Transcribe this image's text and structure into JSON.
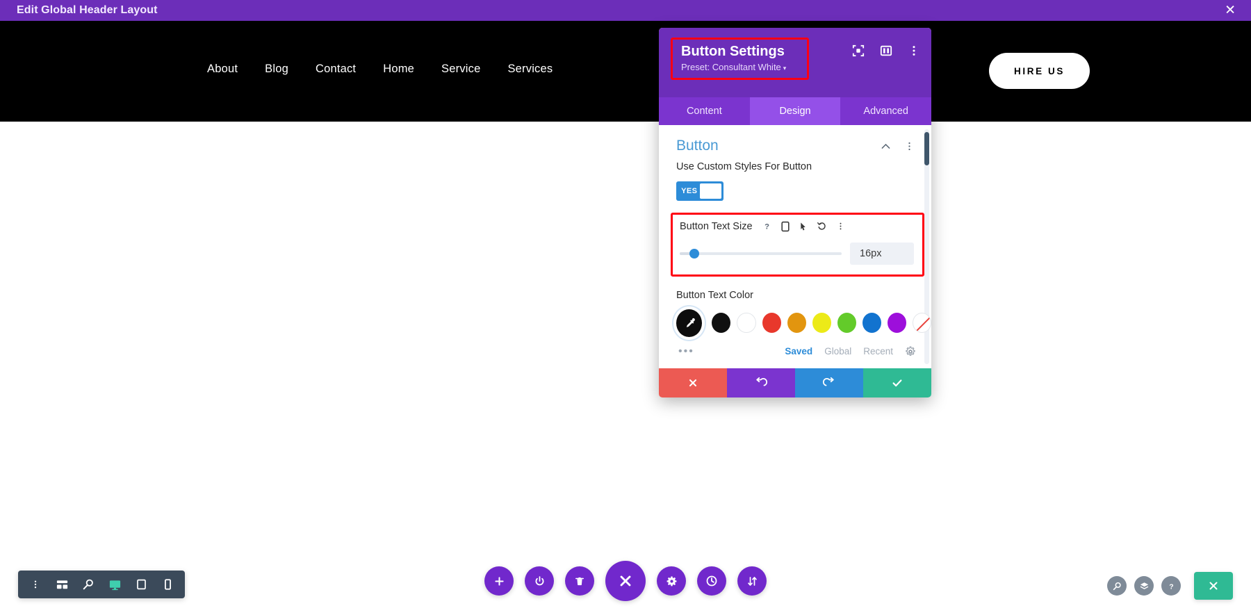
{
  "admin_bar": {
    "title": "Edit Global Header Layout",
    "close_icon": "close-icon"
  },
  "site_header": {
    "nav_items": [
      {
        "label": "About"
      },
      {
        "label": "Blog"
      },
      {
        "label": "Contact"
      },
      {
        "label": "Home"
      },
      {
        "label": "Service"
      },
      {
        "label": "Services"
      }
    ],
    "cta_label": "HIRE US"
  },
  "settings_modal": {
    "title": "Button Settings",
    "preset_label": "Preset: Consultant White",
    "preset_caret": "▾",
    "head_icons": [
      {
        "name": "fullscreen-icon"
      },
      {
        "name": "layout-split-icon"
      },
      {
        "name": "more-vertical-icon"
      }
    ],
    "tabs": [
      {
        "label": "Content",
        "active": false
      },
      {
        "label": "Design",
        "active": true
      },
      {
        "label": "Advanced",
        "active": false
      }
    ],
    "section": {
      "title": "Button",
      "collapse_icon": "chevron-up-icon",
      "more_icon": "more-vertical-icon"
    },
    "custom_styles": {
      "label": "Use Custom Styles For Button",
      "toggle_value": "YES"
    },
    "text_size": {
      "label": "Button Text Size",
      "help_icon": "help-icon",
      "responsive_icon": "mobile-icon",
      "hover_icon": "cursor-icon",
      "reset_icon": "reset-icon",
      "more_icon": "more-vertical-icon",
      "value": "16px",
      "slider_percent": 9
    },
    "text_color": {
      "label": "Button Text Color",
      "picker_icon": "eyedropper-icon",
      "swatches": [
        {
          "name": "swatch-black",
          "hex": "#101010"
        },
        {
          "name": "swatch-white",
          "hex": "#ffffff"
        },
        {
          "name": "swatch-red",
          "hex": "#e8382c"
        },
        {
          "name": "swatch-orange",
          "hex": "#e2950f"
        },
        {
          "name": "swatch-yellow",
          "hex": "#ecea18"
        },
        {
          "name": "swatch-green",
          "hex": "#63cb2a"
        },
        {
          "name": "swatch-blue",
          "hex": "#1273cf"
        },
        {
          "name": "swatch-purple",
          "hex": "#9d0fdb"
        },
        {
          "name": "swatch-none",
          "hex": "transparent"
        }
      ],
      "more_dots": "•••",
      "palette_tabs": [
        {
          "label": "Saved",
          "active": true
        },
        {
          "label": "Global",
          "active": false
        },
        {
          "label": "Recent",
          "active": false
        }
      ],
      "settings_icon": "gear-icon"
    },
    "actions": [
      {
        "name": "cancel-button",
        "icon": "close-icon"
      },
      {
        "name": "undo-button",
        "icon": "undo-icon"
      },
      {
        "name": "redo-button",
        "icon": "redo-icon"
      },
      {
        "name": "save-button",
        "icon": "check-icon"
      }
    ]
  },
  "bottom_left_toolbar": {
    "items": [
      {
        "name": "more-vertical-icon"
      },
      {
        "name": "wireframe-icon"
      },
      {
        "name": "zoom-icon"
      },
      {
        "name": "desktop-icon",
        "active": true
      },
      {
        "name": "tablet-icon"
      },
      {
        "name": "phone-icon"
      }
    ]
  },
  "bottom_center_toolbar": {
    "items": [
      {
        "name": "add-icon"
      },
      {
        "name": "power-icon"
      },
      {
        "name": "trash-icon"
      },
      {
        "name": "close-menu-icon",
        "primary": true
      },
      {
        "name": "gear-icon"
      },
      {
        "name": "history-icon"
      },
      {
        "name": "sort-icon"
      }
    ]
  },
  "bottom_right_toolbar": {
    "items": [
      {
        "name": "zoom-icon"
      },
      {
        "name": "layers-icon"
      },
      {
        "name": "help-icon"
      }
    ],
    "exit_button": {
      "name": "exit-builder-button",
      "icon": "close-icon"
    }
  },
  "colors": {
    "brand_purple": "#6c2eb9",
    "accent_blue": "#2d8cd8",
    "highlight_red": "#ff0014",
    "success_green": "#2fba94"
  }
}
